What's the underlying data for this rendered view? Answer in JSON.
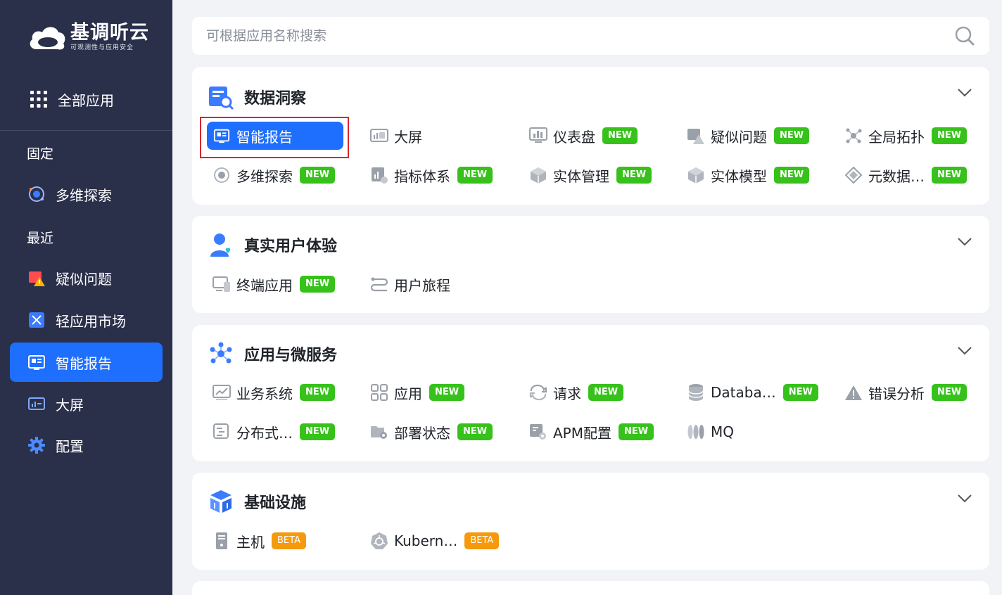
{
  "brand": {
    "name": "基调听云",
    "subtitle": "可观测性与应用安全"
  },
  "sidebar": {
    "all_apps": "全部应用",
    "pinned_label": "固定",
    "pinned": [
      {
        "label": "多维探索",
        "icon": "explore-icon"
      }
    ],
    "recent_label": "最近",
    "recent": [
      {
        "label": "疑似问题",
        "icon": "issue-icon"
      },
      {
        "label": "轻应用市场",
        "icon": "market-icon"
      },
      {
        "label": "智能报告",
        "icon": "report-icon",
        "active": true
      },
      {
        "label": "大屏",
        "icon": "screen-icon"
      },
      {
        "label": "配置",
        "icon": "gear-icon"
      }
    ]
  },
  "search": {
    "placeholder": "可根据应用名称搜索",
    "value": ""
  },
  "sections": [
    {
      "title": "数据洞察",
      "icon": "data-insight-icon",
      "apps": [
        {
          "label": "智能报告",
          "badge": "",
          "selected": true
        },
        {
          "label": "大屏",
          "badge": ""
        },
        {
          "label": "仪表盘",
          "badge": "NEW"
        },
        {
          "label": "疑似问题",
          "badge": "NEW"
        },
        {
          "label": "全局拓扑",
          "badge": "NEW"
        },
        {
          "label": "多维探索",
          "badge": "NEW"
        },
        {
          "label": "指标体系",
          "badge": "NEW"
        },
        {
          "label": "实体管理",
          "badge": "NEW"
        },
        {
          "label": "实体模型",
          "badge": "NEW"
        },
        {
          "label": "元数据…",
          "badge": "NEW"
        }
      ]
    },
    {
      "title": "真实用户体验",
      "icon": "user-experience-icon",
      "apps": [
        {
          "label": "终端应用",
          "badge": "NEW"
        },
        {
          "label": "用户旅程",
          "badge": ""
        }
      ]
    },
    {
      "title": "应用与微服务",
      "icon": "microservice-icon",
      "apps": [
        {
          "label": "业务系统",
          "badge": "NEW"
        },
        {
          "label": "应用",
          "badge": "NEW"
        },
        {
          "label": "请求",
          "badge": "NEW"
        },
        {
          "label": "Databa…",
          "badge": "NEW"
        },
        {
          "label": "错误分析",
          "badge": "NEW"
        },
        {
          "label": "分布式…",
          "badge": "NEW"
        },
        {
          "label": "部署状态",
          "badge": "NEW"
        },
        {
          "label": "APM配置",
          "badge": "NEW"
        },
        {
          "label": "MQ",
          "badge": ""
        }
      ]
    },
    {
      "title": "基础设施",
      "icon": "infrastructure-icon",
      "apps": [
        {
          "label": "主机",
          "badge": "BETA"
        },
        {
          "label": "Kubern…",
          "badge": "BETA"
        }
      ]
    }
  ],
  "colors": {
    "sidebar_bg": "#2a2f4a",
    "accent": "#1f6fff",
    "new_badge": "#36c21a",
    "beta_badge": "#f59a0c",
    "highlight_border": "#d9262c"
  }
}
